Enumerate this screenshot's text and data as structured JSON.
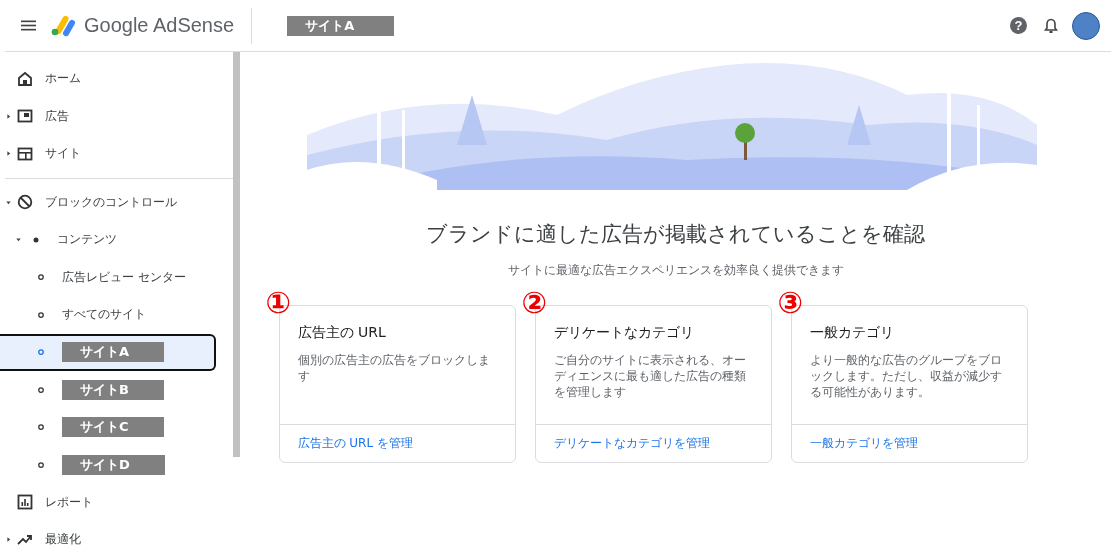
{
  "header": {
    "product": "Google AdSense",
    "site": "サイトA",
    "help": "?"
  },
  "sidebar": {
    "items": [
      {
        "label": "ホーム",
        "selected": false
      },
      {
        "label": "広告",
        "expanded": false,
        "selected": false
      },
      {
        "label": "サイト",
        "expanded": false,
        "selected": false
      },
      {
        "label": "ブロックのコントロール",
        "expanded": true,
        "selected": false,
        "children": [
          {
            "label": "コンテンツ",
            "expanded": true,
            "selected": false,
            "children": [
              {
                "label": "広告レビュー センター",
                "kind": "text",
                "selected": false
              },
              {
                "label": "すべてのサイト",
                "kind": "text",
                "selected": false
              },
              {
                "label": "サイトA",
                "kind": "redacted",
                "selected": true
              },
              {
                "label": "サイトB",
                "kind": "redacted",
                "selected": false
              },
              {
                "label": "サイトC",
                "kind": "redacted",
                "selected": false
              },
              {
                "label": "サイトD",
                "kind": "redacted",
                "selected": false
              }
            ]
          }
        ]
      },
      {
        "label": "レポート",
        "selected": false
      },
      {
        "label": "最適化",
        "expanded": false,
        "selected": false
      }
    ]
  },
  "main": {
    "title": "ブランドに適した広告が掲載されていることを確認",
    "subtitle": "サイトに最適な広告エクスペリエンスを効率良く提供できます",
    "cards": [
      {
        "marker": "①",
        "title": "広告主の URL",
        "description": "個別の広告主の広告をブロックします",
        "link": "広告主の URL を管理"
      },
      {
        "marker": "②",
        "title": "デリケートなカテゴリ",
        "description": "ご自分のサイトに表示される、オーディエンスに最も適した広告の種類を管理します",
        "link": "デリケートなカテゴリを管理"
      },
      {
        "marker": "③",
        "title": "一般カテゴリ",
        "description": "より一般的な広告のグループをブロックします。ただし、収益が減少する可能性があります。",
        "link": "一般カテゴリを管理"
      }
    ]
  }
}
